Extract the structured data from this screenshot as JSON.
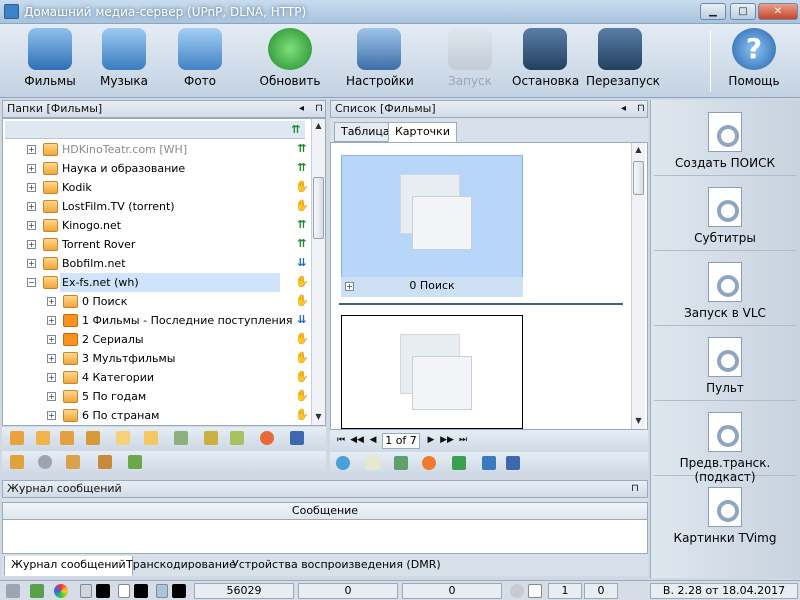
{
  "window": {
    "title": "Домашний медиа-сервер (UPnP, DLNA, HTTP)"
  },
  "toolbar": {
    "films": "Фильмы",
    "music": "Музыка",
    "photo": "Фото",
    "refresh": "Обновить",
    "settings": "Настройки",
    "start": "Запуск",
    "stop": "Остановка",
    "restart": "Перезапуск",
    "help": "Помощь"
  },
  "folders": {
    "header": "Папки [Фильмы]",
    "items": [
      {
        "label": "HDKinoTeatr.com [WH]"
      },
      {
        "label": "Наука и образование"
      },
      {
        "label": "Kodik"
      },
      {
        "label": "LostFilm.TV (torrent)"
      },
      {
        "label": "Kinogo.net"
      },
      {
        "label": "Torrent Rover"
      },
      {
        "label": "Bobfilm.net"
      },
      {
        "label": "Ex-fs.net (wh)"
      },
      {
        "label": "0 Поиск"
      },
      {
        "label": "1 Фильмы - Последние поступления"
      },
      {
        "label": "2 Сериалы"
      },
      {
        "label": "3 Мультфильмы"
      },
      {
        "label": "4 Категории"
      },
      {
        "label": "5 По годам"
      },
      {
        "label": "6 По странам"
      }
    ]
  },
  "list": {
    "header": "Список [Фильмы]",
    "tabs": [
      "Таблица",
      "Карточки"
    ],
    "card1_caption": "0 Поиск",
    "page": "1 of 7"
  },
  "right_panel": {
    "buttons": [
      "Создать ПОИСК",
      "Субтитры",
      "Запуск в VLC",
      "Пульт",
      "Предв.транск.(подкаст)",
      "Картинки TVimg"
    ]
  },
  "log": {
    "header": "Журнал сообщений",
    "column": "Сообщение",
    "tabs": [
      "Журнал сообщений",
      "Транскодирование",
      "Устройства воспроизведения (DMR)"
    ]
  },
  "status": {
    "count": "56029",
    "f1": "0",
    "f2": "0",
    "f3": "1",
    "f4": "0",
    "version": "В. 2.28 от 18.04.2017"
  }
}
